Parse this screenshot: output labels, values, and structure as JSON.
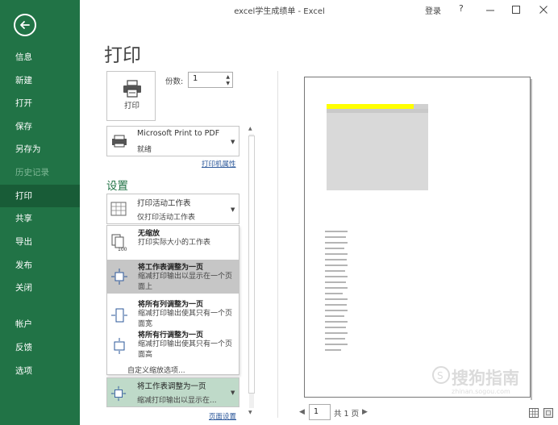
{
  "window": {
    "title": "excel学生成绩单  -  Excel",
    "login": "登录",
    "help": "?"
  },
  "colors": {
    "sidebar": "#217346",
    "sidebar_active": "#185c37",
    "accent": "#217346",
    "link": "#2b579a",
    "selected_option": "#bfdac9"
  },
  "sidebar": {
    "back_icon": "back-arrow-icon",
    "items": [
      {
        "label": "信息"
      },
      {
        "label": "新建"
      },
      {
        "label": "打开"
      },
      {
        "label": "保存"
      },
      {
        "label": "另存为"
      },
      {
        "label": "历史记录"
      },
      {
        "label": "打印"
      },
      {
        "label": "共享"
      },
      {
        "label": "导出"
      },
      {
        "label": "发布"
      },
      {
        "label": "关闭"
      },
      {
        "label": "帐户"
      },
      {
        "label": "反馈"
      },
      {
        "label": "选项"
      }
    ]
  },
  "print": {
    "title": "打印",
    "button_label": "打印",
    "copies_label": "份数:",
    "copies_value": "1",
    "printer_name": "Microsoft Print to PDF",
    "printer_status": "就绪",
    "printer_properties": "打印机属性",
    "settings_title": "设置",
    "what_title": "打印活动工作表",
    "what_sub": "仅打印活动工作表",
    "scaling_options": [
      {
        "title": "无缩放",
        "desc": "打印实际大小的工作表"
      },
      {
        "title": "将工作表调整为一页",
        "desc": "缩减打印输出以显示在一个页面上"
      },
      {
        "title": "将所有列调整为一页",
        "desc": "缩减打印输出使其只有一个页面宽"
      },
      {
        "title": "将所有行调整为一页",
        "desc": "缩减打印输出使其只有一个页面高"
      }
    ],
    "custom_scaling": "自定义缩放选项...",
    "selected_scaling_title": "将工作表调整为一页",
    "selected_scaling_sub": "缩减打印输出以显示在...",
    "page_setup": "页面设置"
  },
  "pager": {
    "current": "1",
    "total_text": "共 1 页"
  },
  "watermark": {
    "text": "搜狗指南",
    "sub": "zhinan.sogou.com"
  }
}
